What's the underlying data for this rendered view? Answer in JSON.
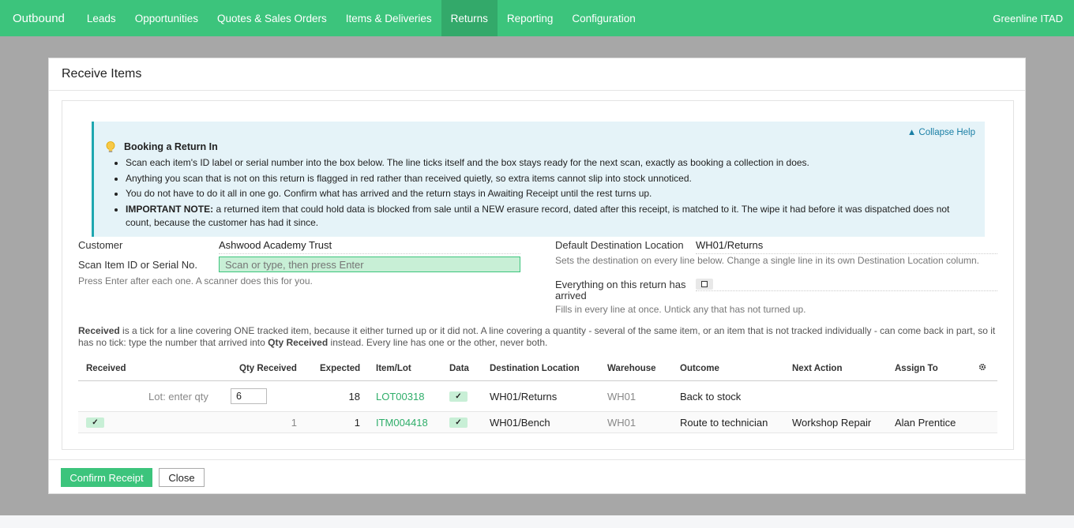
{
  "nav": {
    "brand": "Outbound",
    "items": [
      "Leads",
      "Opportunities",
      "Quotes & Sales Orders",
      "Items & Deliveries",
      "Returns",
      "Reporting",
      "Configuration"
    ],
    "active": "Returns",
    "company": "Greenline ITAD"
  },
  "modal": {
    "title": "Receive Items",
    "help": {
      "collapse": "▲ Collapse Help",
      "title": "Booking a Return In",
      "bullets": [
        "Scan each item's ID label or serial number into the box below. The line ticks itself and the box stays ready for the next scan, exactly as booking a collection in does.",
        "Anything you scan that is not on this return is flagged in red rather than received quietly, so extra items cannot slip into stock unnoticed.",
        "You do not have to do it all in one go. Confirm what has arrived and the return stays in Awaiting Receipt until the rest turns up."
      ],
      "note_label": "IMPORTANT NOTE:",
      "note_text": " a returned item that could hold data is blocked from sale until a NEW erasure record, dated after this receipt, is matched to it. The wipe it had before it was dispatched does not count, because the customer has had it since."
    },
    "form": {
      "customer_label": "Customer",
      "customer_value": "Ashwood Academy Trust",
      "scan_label": "Scan Item ID or Serial No.",
      "scan_placeholder": "Scan or type, then press Enter",
      "scan_hint": "Press Enter after each one. A scanner does this for you.",
      "dest_label": "Default Destination Location",
      "dest_value": "WH01/Returns",
      "dest_hint": "Sets the destination on every line below. Change a single line in its own Destination Location column.",
      "arrived_label_1": "Everything on this return has",
      "arrived_label_2": "arrived",
      "arrived_hint": "Fills in every line at once. Untick any that has not turned up."
    },
    "para": {
      "b1": "Received",
      "t1": " is a tick for a line covering ONE tracked item, because it either turned up or it did not. A line covering a quantity - several of the same item, or an item that is not tracked individually - can come back in part, so it has no tick: type the number that arrived into ",
      "b2": "Qty Received",
      "t2": " instead. Every line has one or the other, never both."
    },
    "table": {
      "headers": {
        "received": "Received",
        "qty": "Qty Received",
        "expected": "Expected",
        "item": "Item/Lot",
        "data": "Data",
        "dest": "Destination Location",
        "warehouse": "Warehouse",
        "outcome": "Outcome",
        "next": "Next Action",
        "assign": "Assign To"
      },
      "rows": [
        {
          "received": "Lot: enter qty",
          "qty": "6",
          "expected": "18",
          "item": "LOT00318",
          "data": "✓",
          "dest": "WH01/Returns",
          "warehouse": "WH01",
          "outcome": "Back to stock",
          "next": "",
          "assign": ""
        },
        {
          "received": "✓",
          "qty": "1",
          "expected": "1",
          "item": "ITM004418",
          "data": "✓",
          "dest": "WH01/Bench",
          "warehouse": "WH01",
          "outcome": "Route to technician",
          "next": "Workshop Repair",
          "assign": "Alan Prentice"
        }
      ]
    },
    "footer": {
      "confirm": "Confirm Receipt",
      "close": "Close"
    }
  },
  "colors": {
    "brand": "#3cc47c",
    "nav_active": "#33a96a",
    "help_bg": "#e5f3f8",
    "help_border": "#1fa7b0",
    "link": "#2fae6a"
  },
  "icons": {
    "help": "lightbulb-icon",
    "columns": "gear-icon"
  }
}
